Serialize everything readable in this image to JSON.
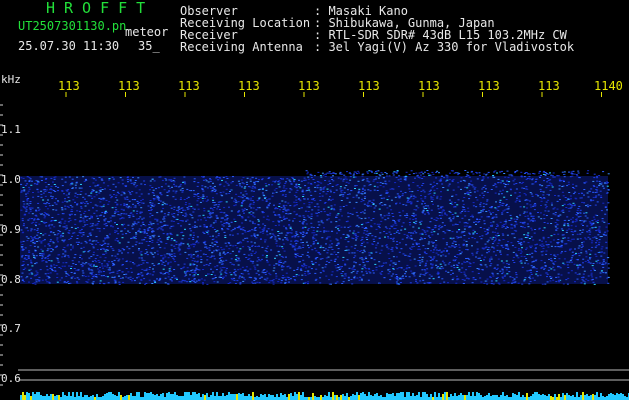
{
  "header": {
    "title": "HROFFT",
    "filename": "UT2507301130.pn",
    "mode": "meteor",
    "datetime": "25.07.30 11:30",
    "count": "35_",
    "info": [
      {
        "label": "Observer",
        "value": ": Masaki Kano"
      },
      {
        "label": "Receiving Location",
        "value": ": Shibukawa, Gunma, Japan"
      },
      {
        "label": "Receiver",
        "value": ": RTL-SDR SDR# 43dB L15 103.2MHz CW"
      },
      {
        "label": "Receiving Antenna",
        "value": ": 3el Yagi(V) Az 330 for Vladivostok"
      }
    ]
  },
  "x_axis": {
    "unit": "kHz",
    "ticks": [
      "113",
      "113",
      "113",
      "113",
      "113",
      "113",
      "113",
      "113",
      "113",
      "1140"
    ]
  },
  "y_axis": {
    "ticks": [
      "1.1",
      "1.0",
      "0.9",
      "0.8",
      "0.7",
      "0.6"
    ]
  },
  "colors": {
    "background": "#000000",
    "header_green": "#22e03a",
    "header_white": "#e8e8e8",
    "tick_yellow": "#e6e600",
    "noise_blue": "#1a2fd0",
    "noise_cyan": "#29d4ff",
    "baseline_cyan": "#22c8ff"
  }
}
